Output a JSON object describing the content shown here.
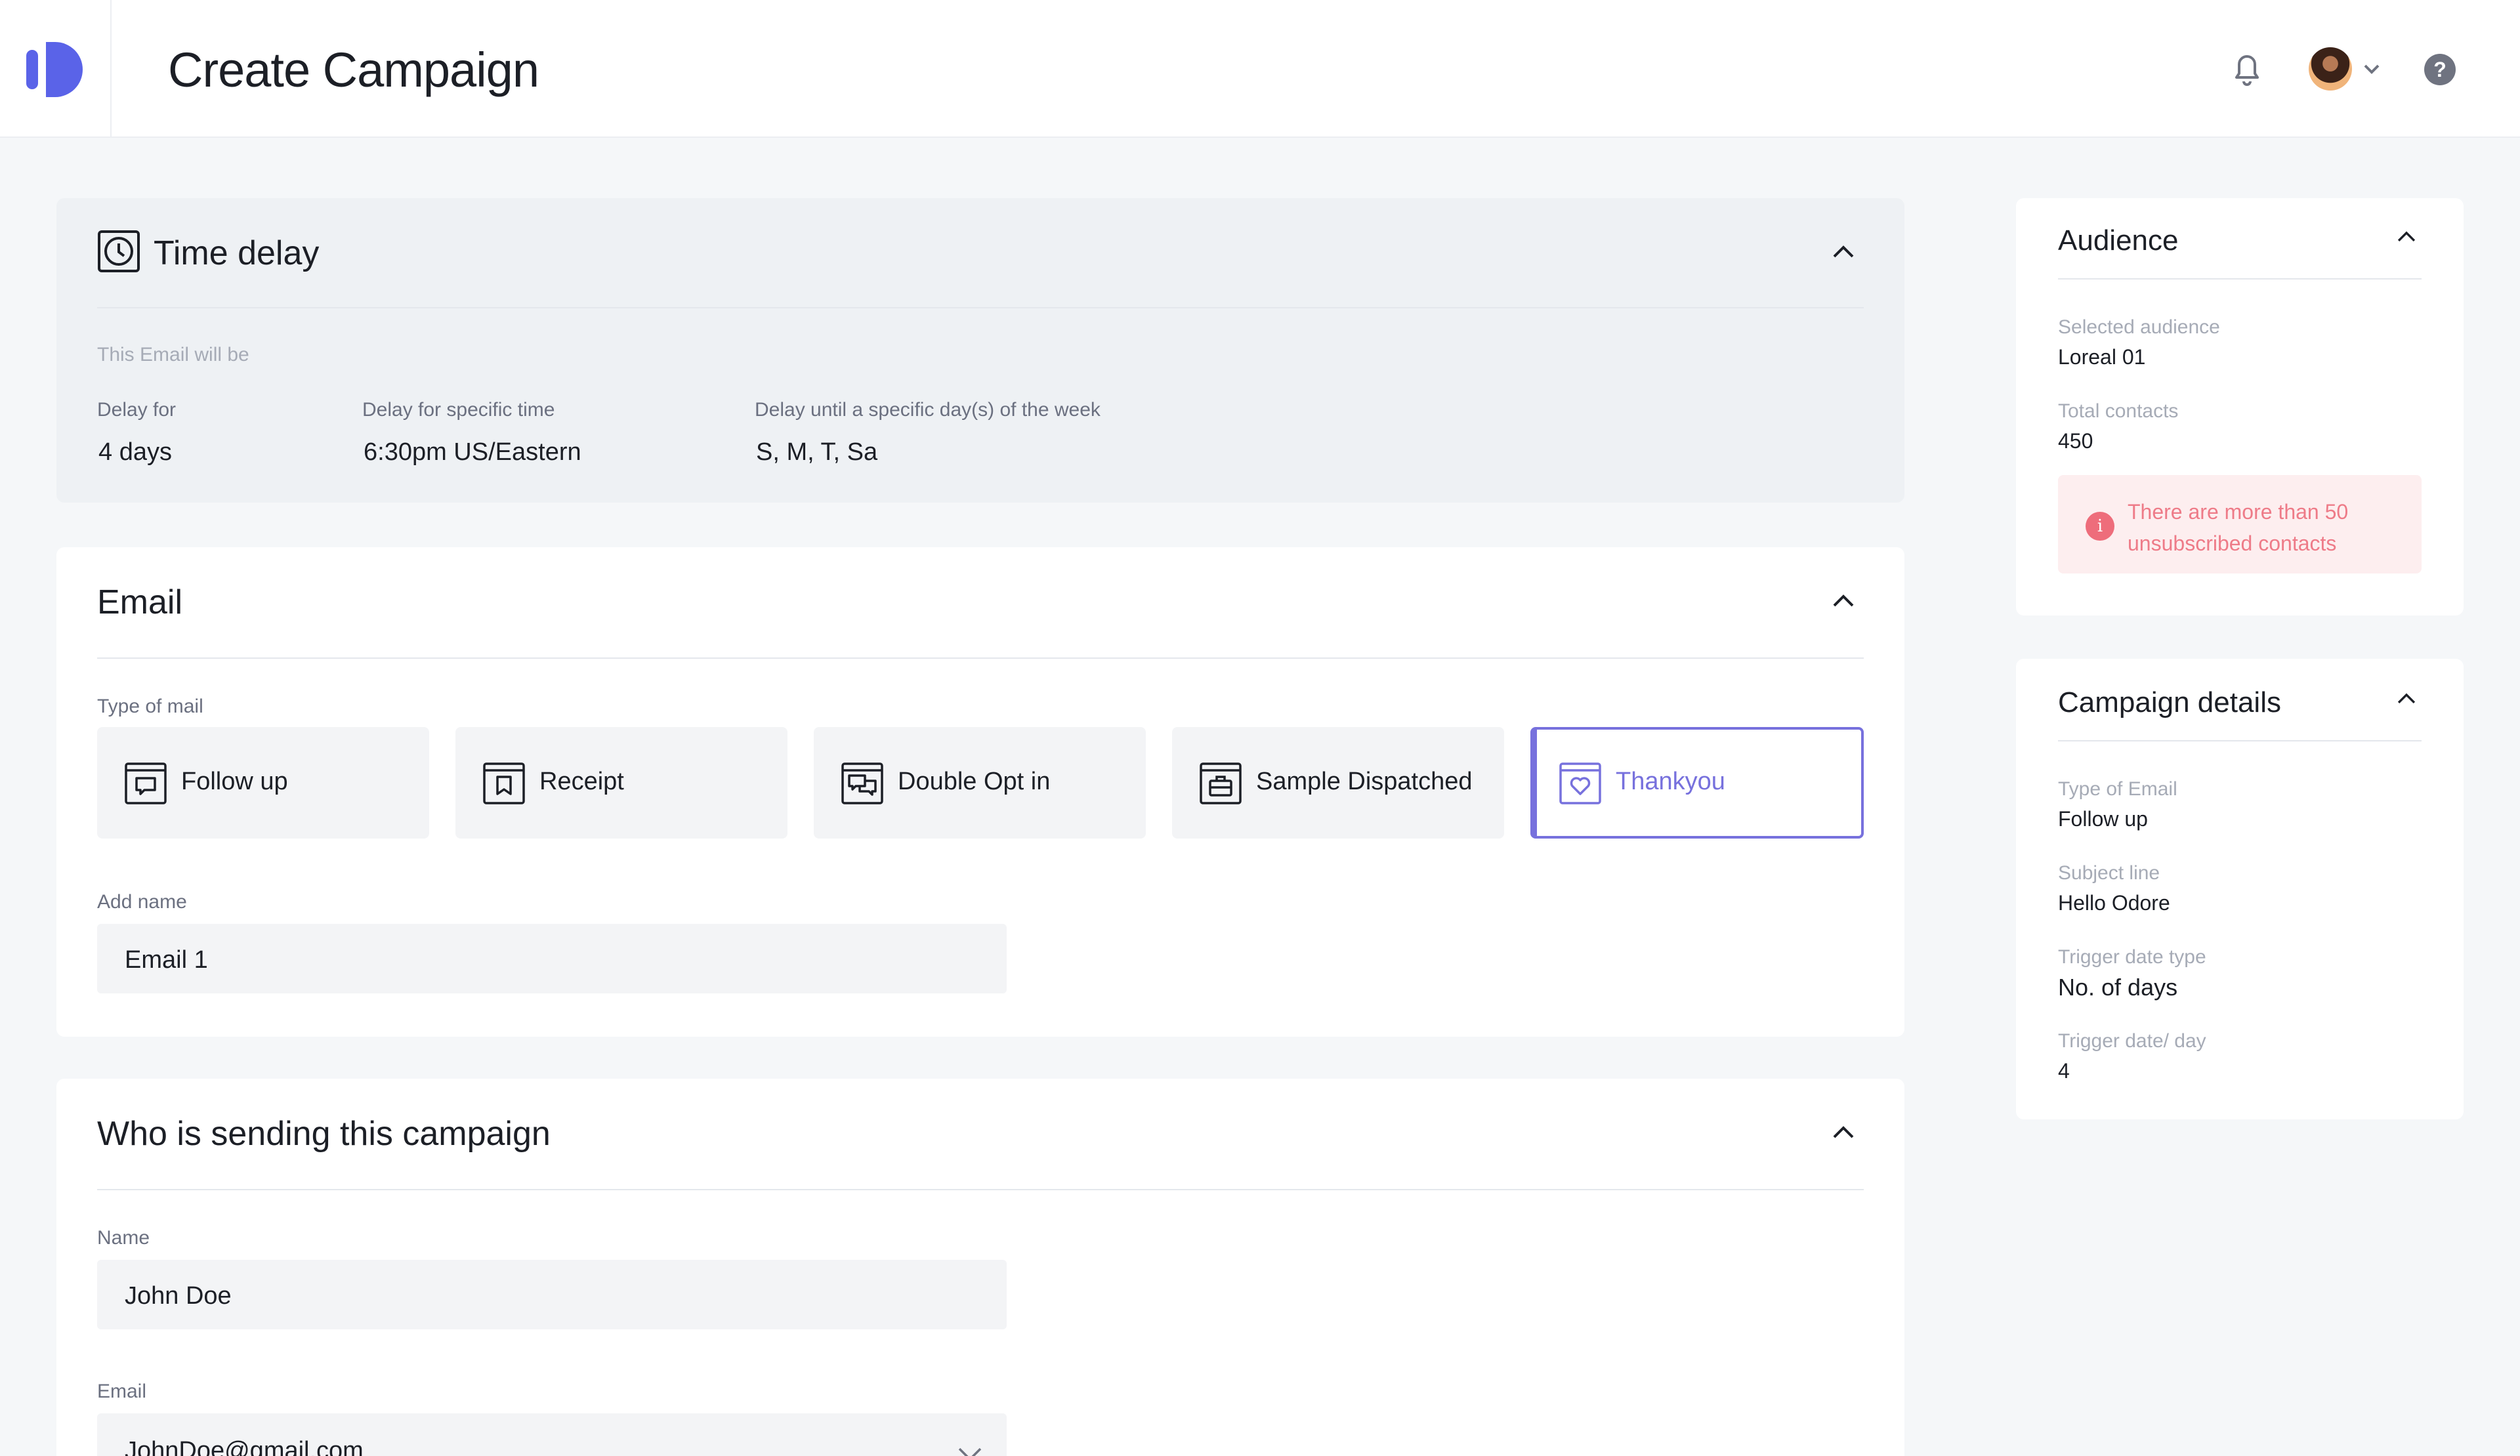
{
  "header": {
    "title": "Create Campaign",
    "help_glyph": "?"
  },
  "time_delay": {
    "title": "Time delay",
    "intro": "This Email will be",
    "fields": [
      {
        "label": "Delay for",
        "value": "4 days"
      },
      {
        "label": "Delay for specific time",
        "value": "6:30pm US/Eastern"
      },
      {
        "label": "Delay until a specific day(s) of the week",
        "value": "S, M, T, Sa"
      }
    ]
  },
  "email": {
    "title": "Email",
    "type_label": "Type of mail",
    "types": [
      {
        "label": "Follow up",
        "icon": "message-icon",
        "selected": false
      },
      {
        "label": "Receipt",
        "icon": "bookmark-icon",
        "selected": false
      },
      {
        "label": "Double Opt in",
        "icon": "chat-bubbles-icon",
        "selected": false
      },
      {
        "label": "Sample Dispatched",
        "icon": "briefcase-icon",
        "selected": false
      },
      {
        "label": "Thankyou",
        "icon": "heart-icon",
        "selected": true
      }
    ],
    "name_label": "Add name",
    "name_value": "Email 1"
  },
  "sender": {
    "title": "Who is sending this campaign",
    "name_label": "Name",
    "name_value": "John Doe",
    "email_label": "Email",
    "email_value": "JohnDoe@gmail.com"
  },
  "audience": {
    "title": "Audience",
    "selected_label": "Selected audience",
    "selected_value": "Loreal 01",
    "contacts_label": "Total contacts",
    "contacts_value": "450",
    "alert_glyph": "i",
    "alert": "There are more than 50 unsubscribed contacts"
  },
  "campaign_details": {
    "title": "Campaign details",
    "items": [
      {
        "label": "Type of Email",
        "value": "Follow up"
      },
      {
        "label": "Subject line",
        "value": "Hello Odore"
      },
      {
        "label": "Trigger date type",
        "value": "No. of days"
      },
      {
        "label": "Trigger date/ day",
        "value": "4"
      }
    ]
  },
  "colors": {
    "accent": "#7771dd",
    "alert": "#ee6d7b",
    "page_bg": "#f5f7f9"
  }
}
